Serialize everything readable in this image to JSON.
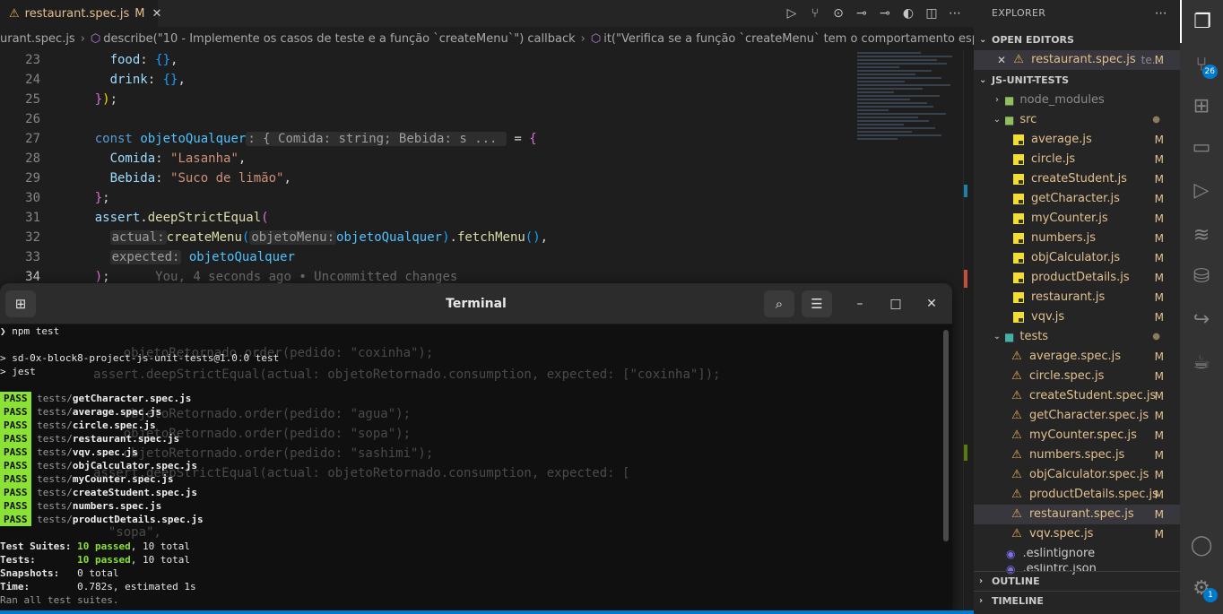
{
  "tab": {
    "filename": "restaurant.spec.js",
    "modified": "M"
  },
  "breadcrumb": {
    "file": "urant.spec.js",
    "describe": "describe(\"10 - Implemente os casos de teste e a função `createMenu`\") callback",
    "it": "it(\"Verifica se a função `createMenu` tem o comportamento esperado\") callback"
  },
  "editor": {
    "line_numbers": [
      "23",
      "24",
      "25",
      "26",
      "27",
      "28",
      "29",
      "30",
      "31",
      "32",
      "33",
      "34"
    ],
    "blame": "You, 4 seconds ago • Uncommitted changes",
    "code": {
      "food_key": "food",
      "drink_key": "drink",
      "const_kw": "const",
      "var_name": "objetoQualquer",
      "type_hint": ": { Comida: string; Bebida: s ... ",
      "comida_key": "Comida",
      "comida_val": "\"Lasanha\"",
      "bebida_key": "Bebida",
      "bebida_val": "\"Suco de limão\"",
      "assert_obj": "assert",
      "assert_fn": "deepStrictEqual",
      "actual_hint": "actual:",
      "create_fn": "createMenu",
      "menu_hint": "objetoMenu:",
      "arg": "objetoQualquer",
      "fetch_fn": "fetchMenu",
      "expected_hint": "expected:",
      "expected_val": "objetoQualquer"
    }
  },
  "terminal": {
    "title": "Terminal",
    "prompt": "❯ npm test",
    "script_line": "> sd-0x-block8-project-js-unit-tests@1.0.0 test",
    "jest_line": "> jest",
    "pass_label": "PASS",
    "results": [
      {
        "dir": "tests/",
        "file": "getCharacter.spec.js"
      },
      {
        "dir": "tests/",
        "file": "average.spec.js"
      },
      {
        "dir": "tests/",
        "file": "circle.spec.js"
      },
      {
        "dir": "tests/",
        "file": "restaurant.spec.js"
      },
      {
        "dir": "tests/",
        "file": "vqv.spec.js"
      },
      {
        "dir": "tests/",
        "file": "objCalculator.spec.js"
      },
      {
        "dir": "tests/",
        "file": "myCounter.spec.js"
      },
      {
        "dir": "tests/",
        "file": "createStudent.spec.js"
      },
      {
        "dir": "tests/",
        "file": "numbers.spec.js"
      },
      {
        "dir": "tests/",
        "file": "productDetails.spec.js"
      }
    ],
    "summary": {
      "suites_label": "Test Suites:",
      "suites_passed": "10 passed",
      "suites_total": ", 10 total",
      "tests_label": "Tests:",
      "tests_passed": "10 passed",
      "tests_total": ", 10 total",
      "snapshots_label": "Snapshots:",
      "snapshots_value": "0 total",
      "time_label": "Time:",
      "time_value": "0.782s, estimated 1s",
      "footer": "Ran all test suites."
    },
    "background_code": [
      {
        "line": "    objetoRetornado.order(pedido: \"coxinha\");"
      },
      {
        "line": "assert.deepStrictEqual(actual: objetoRetornado.consumption, expected: [\"coxinha\"]);"
      },
      {
        "line": "    objetoRetornado.order(pedido: \"agua\");"
      },
      {
        "line": "    objetoRetornado.order(pedido: \"sopa\");"
      },
      {
        "line": "    objetoRetornado.order(pedido: \"sashimi\");"
      },
      {
        "line": "assert.deepStrictEqual(actual: objetoRetornado.consumption, expected: ["
      },
      {
        "line": "  \"sopa\","
      }
    ]
  },
  "sidebar": {
    "title": "EXPLORER",
    "open_editors_label": "OPEN EDITORS",
    "open_editor_file": "restaurant.spec.js",
    "open_editor_path": "te...",
    "open_editor_badge": "M",
    "workspace_label": "JS-UNIT-TESTS",
    "node_modules": "node_modules",
    "src_folder": "src",
    "src_files": [
      {
        "name": "average.js",
        "badge": "M"
      },
      {
        "name": "circle.js",
        "badge": "M"
      },
      {
        "name": "createStudent.js",
        "badge": "M"
      },
      {
        "name": "getCharacter.js",
        "badge": "M"
      },
      {
        "name": "myCounter.js",
        "badge": "M"
      },
      {
        "name": "numbers.js",
        "badge": "M"
      },
      {
        "name": "objCalculator.js",
        "badge": "M"
      },
      {
        "name": "productDetails.js",
        "badge": "M"
      },
      {
        "name": "restaurant.js",
        "badge": "M"
      },
      {
        "name": "vqv.js",
        "badge": "M"
      }
    ],
    "tests_folder": "tests",
    "test_files": [
      {
        "name": "average.spec.js",
        "badge": "M"
      },
      {
        "name": "circle.spec.js",
        "badge": "M"
      },
      {
        "name": "createStudent.spec.js",
        "badge": "M"
      },
      {
        "name": "getCharacter.spec.js",
        "badge": "M"
      },
      {
        "name": "myCounter.spec.js",
        "badge": "M"
      },
      {
        "name": "numbers.spec.js",
        "badge": "M"
      },
      {
        "name": "objCalculator.spec.js",
        "badge": "M"
      },
      {
        "name": "productDetails.spec.js",
        "badge": "M"
      },
      {
        "name": "restaurant.spec.js",
        "badge": "M"
      },
      {
        "name": "vqv.spec.js",
        "badge": "M"
      }
    ],
    "eslintignore": ".eslintignore",
    "eslintrc": ".eslintrc.json",
    "outline_label": "OUTLINE",
    "timeline_label": "TIMELINE"
  },
  "activity": {
    "scm_badge": "26",
    "accounts_badge": "1"
  },
  "colors": {
    "accent": "#007acc",
    "modified": "#e2c08d",
    "pass": "#8ae234"
  }
}
